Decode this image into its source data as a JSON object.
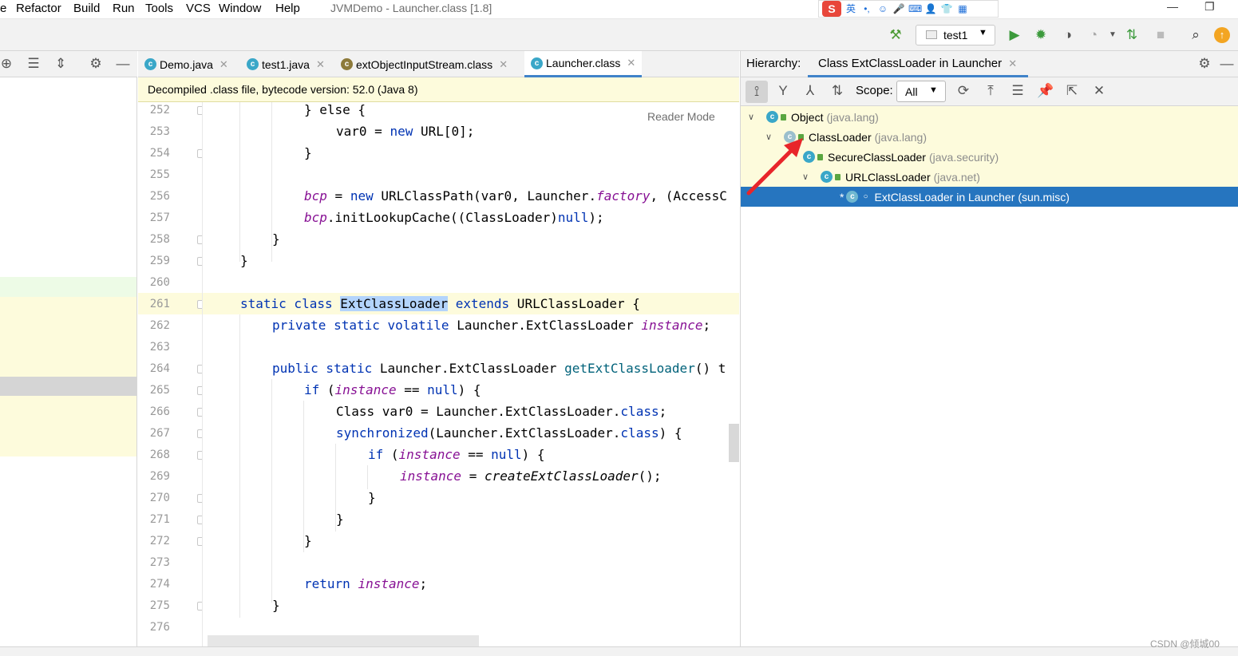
{
  "menu": [
    "e",
    "Refactor",
    "Build",
    "Run",
    "Tools",
    "VCS",
    "Window",
    "Help"
  ],
  "window_title": "JVMDemo - Launcher.class [1.8]",
  "ime": {
    "label": "S",
    "lang": "英"
  },
  "window_controls": {
    "minimize": "—",
    "restore": "❐"
  },
  "toolbar": {
    "run_config": "test1"
  },
  "tabs": [
    {
      "label": "Demo.java"
    },
    {
      "label": "test1.java"
    },
    {
      "label": "extObjectInputStream.class"
    },
    {
      "label": "Launcher.class"
    }
  ],
  "banner": "Decompiled .class file, bytecode version: 52.0 (Java 8)",
  "reader_mode": "Reader Mode",
  "line_numbers": [
    "252",
    "253",
    "254",
    "255",
    "256",
    "257",
    "258",
    "259",
    "260",
    "261",
    "262",
    "263",
    "264",
    "265",
    "266",
    "267",
    "268",
    "269",
    "270",
    "271",
    "272",
    "273",
    "274",
    "275",
    "276"
  ],
  "code": {
    "l252": "} else {",
    "l253a": "var0 = ",
    "l253b": "new",
    "l253c": " URL[0];",
    "l254": "}",
    "l256a": "bcp",
    "l256b": " = ",
    "l256c": "new",
    "l256d": " URLClassPath(var0, Launcher.",
    "l256e": "factory",
    "l256f": ", (AccessC",
    "l257a": "bcp",
    "l257b": ".initLookupCache((ClassLoader)",
    "l257c": "null",
    "l257d": ");",
    "l258": "}",
    "l259": "}",
    "l261a": "static class",
    "l261b": "ExtClassLoader",
    "l261c": "extends",
    "l261d": " URLClassLoader {",
    "l262a": "private static volatile",
    "l262b": " Launcher.ExtClassLoader ",
    "l262c": "instance",
    "l262d": ";",
    "l264a": "public static",
    "l264b": " Launcher.ExtClassLoader ",
    "l264c": "getExtClassLoader",
    "l264d": "() t",
    "l265a": "if",
    "l265b": " (",
    "l265c": "instance",
    "l265d": " == ",
    "l265e": "null",
    "l265f": ") {",
    "l266a": "Class var0 = Launcher.ExtClassLoader.",
    "l266b": "class",
    "l266c": ";",
    "l267a": "synchronized",
    "l267b": "(Launcher.ExtClassLoader.",
    "l267c": "class",
    "l267d": ") {",
    "l268a": "if",
    "l268b": " (",
    "l268c": "instance",
    "l268d": " == ",
    "l268e": "null",
    "l268f": ") {",
    "l269a": "instance",
    "l269b": " = ",
    "l269c": "createExtClassLoader",
    "l269d": "();",
    "l270": "}",
    "l271": "}",
    "l272": "}",
    "l274a": "return",
    "l274b": "instance",
    "l274c": ";",
    "l275": "}"
  },
  "hierarchy": {
    "label": "Hierarchy:",
    "tab": "Class ExtClassLoader in Launcher",
    "scope_label": "Scope:",
    "scope_value": "All",
    "tree": [
      {
        "name": "Object",
        "pkg": "(java.lang)"
      },
      {
        "name": "ClassLoader",
        "pkg": "(java.lang)"
      },
      {
        "name": "SecureClassLoader",
        "pkg": "(java.security)"
      },
      {
        "name": "URLClassLoader",
        "pkg": "(java.net)"
      },
      {
        "name": "ExtClassLoader in Launcher",
        "pkg": "(sun.misc)"
      }
    ]
  },
  "watermark": "CSDN @倾城00",
  "colors": {
    "accent": "#2675bf",
    "keyword": "#0033b3",
    "field": "#871094",
    "method": "#00627a",
    "banner": "#fdfbdc",
    "arrow": "#e8252a"
  }
}
